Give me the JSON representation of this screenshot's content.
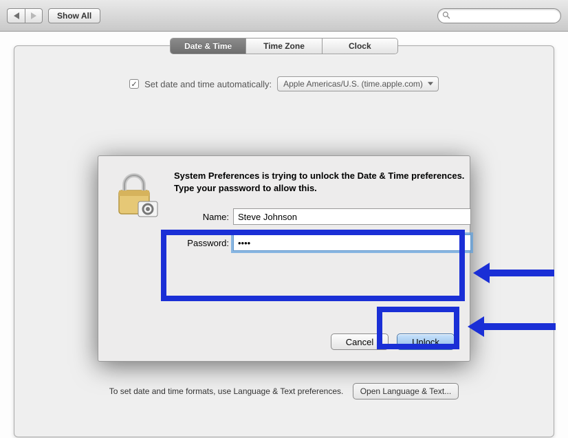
{
  "toolbar": {
    "show_all_label": "Show All",
    "search_placeholder": ""
  },
  "tabs": {
    "items": [
      "Date & Time",
      "Time Zone",
      "Clock"
    ],
    "selected_index": 0
  },
  "auto": {
    "checkbox_label": "Set date and time automatically:",
    "checked": true,
    "server": "Apple Americas/U.S. (time.apple.com)"
  },
  "dialog": {
    "message": "System Preferences is trying to unlock the Date & Time preferences. Type your password to allow this.",
    "name_label": "Name:",
    "name_value": "Steve Johnson",
    "password_label": "Password:",
    "password_value": "••••",
    "cancel_label": "Cancel",
    "unlock_label": "Unlock"
  },
  "footer": {
    "text": "To set date and time formats, use Language & Text preferences.",
    "button_label": "Open Language & Text..."
  },
  "annotation": {
    "highlight_color": "#1a2fd6"
  }
}
